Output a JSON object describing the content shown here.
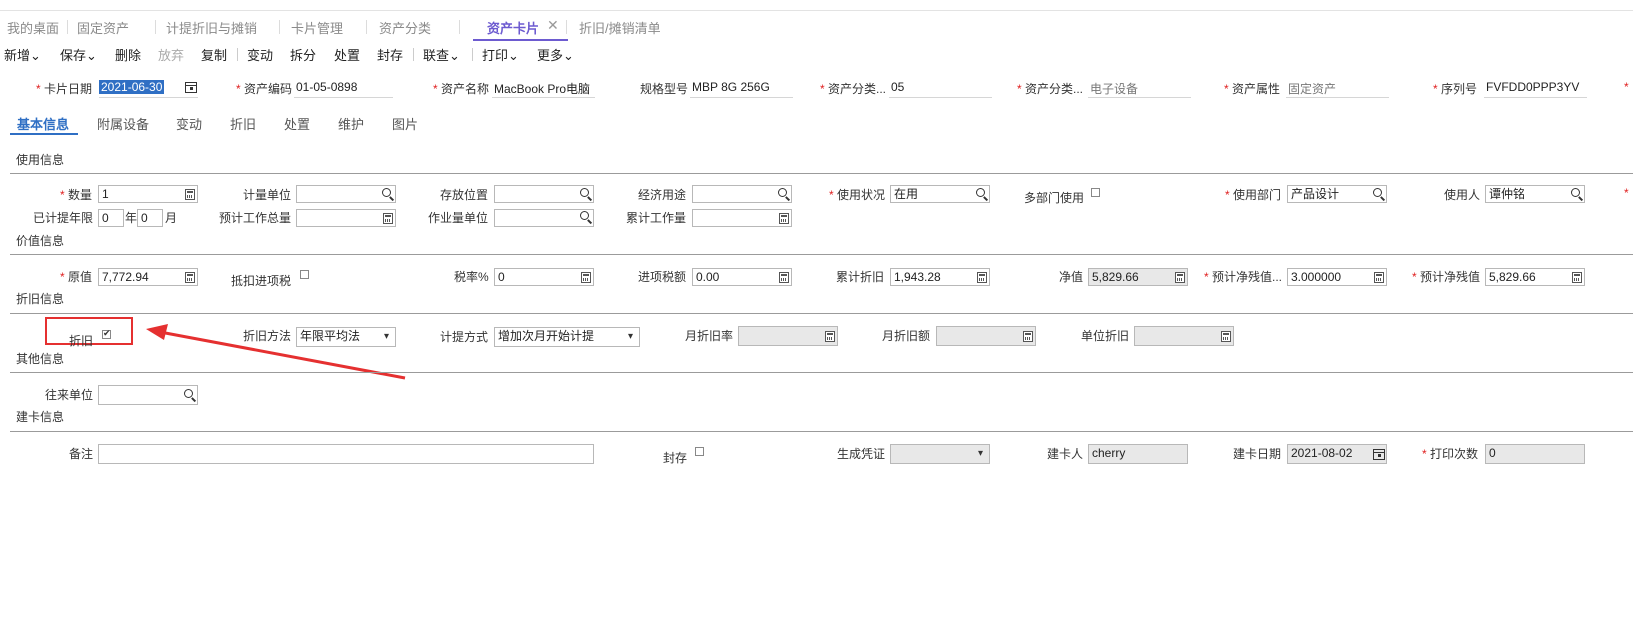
{
  "tabs": [
    "我的桌面",
    "固定资产",
    "计提折旧与摊销",
    "卡片管理",
    "资产分类",
    "资产卡片",
    "折旧/摊销清单"
  ],
  "toolbar": {
    "new": "新增",
    "save": "保存",
    "delete": "删除",
    "abandon": "放弃",
    "copy": "复制",
    "change": "变动",
    "split": "拆分",
    "dispose": "处置",
    "seal": "封存",
    "query": "联查",
    "print": "打印",
    "more": "更多"
  },
  "header": {
    "card_date_label": "卡片日期",
    "card_date": "2021-06-30",
    "asset_code_label": "资产编码",
    "asset_code": "01-05-0898",
    "asset_name_label": "资产名称",
    "asset_name": "MacBook Pro电脑",
    "spec_label": "规格型号",
    "spec": "MBP 8G 256G",
    "category_code_label": "资产分类...",
    "category_code": "05",
    "category_name_label": "资产分类...",
    "category_name": "电子设备",
    "attr_label": "资产属性",
    "attr": "固定资产",
    "serial_label": "序列号",
    "serial": "FVFDD0PPP3YV"
  },
  "subtabs": [
    "基本信息",
    "附属设备",
    "变动",
    "折旧",
    "处置",
    "维护",
    "图片"
  ],
  "sections": {
    "usage": "使用信息",
    "value": "价值信息",
    "depr": "折旧信息",
    "other": "其他信息",
    "create": "建卡信息"
  },
  "usage": {
    "qty_label": "数量",
    "qty": "1",
    "unit_label": "计量单位",
    "location_label": "存放位置",
    "purpose_label": "经济用途",
    "status_label": "使用状况",
    "status": "在用",
    "multi_dept_label": "多部门使用",
    "dept_label": "使用部门",
    "dept": "产品设计",
    "user_label": "使用人",
    "user": "谭仲铭",
    "life_label": "已计提年限",
    "years": "0",
    "year_unit": "年",
    "months": "0",
    "month_unit": "月",
    "total_work_label": "预计工作总量",
    "work_unit_label": "作业量单位",
    "accum_work_label": "累计工作量"
  },
  "value": {
    "orig_label": "原值",
    "orig": "7,772.94",
    "deduct_label": "抵扣进项税",
    "tax_rate_label": "税率%",
    "tax_rate": "0",
    "input_tax_label": "进项税额",
    "input_tax": "0.00",
    "accum_depr_label": "累计折旧",
    "accum_depr": "1,943.28",
    "net_label": "净值",
    "net": "5,829.66",
    "residual_rate_label": "预计净残值...",
    "residual_rate": "3.000000",
    "residual_label": "预计净残值",
    "residual": "5,829.66"
  },
  "depr": {
    "depr_label": "折旧",
    "method_label": "折旧方法",
    "method": "年限平均法",
    "mode_label": "计提方式",
    "mode": "增加次月开始计提",
    "month_rate_label": "月折旧率",
    "month_amt_label": "月折旧额",
    "unit_depr_label": "单位折旧"
  },
  "other": {
    "partner_label": "往来单位"
  },
  "create": {
    "note_label": "备注",
    "seal_label": "封存",
    "voucher_label": "生成凭证",
    "creator_label": "建卡人",
    "creator": "cherry",
    "create_date_label": "建卡日期",
    "create_date": "2021-08-02",
    "print_count_label": "打印次数",
    "print_count": "0"
  },
  "colors": {
    "accent": "#6d5bd0",
    "link": "#2f6fc4",
    "required": "#e02020",
    "highlight_box": "#e53030",
    "arrow": "#e53030"
  }
}
